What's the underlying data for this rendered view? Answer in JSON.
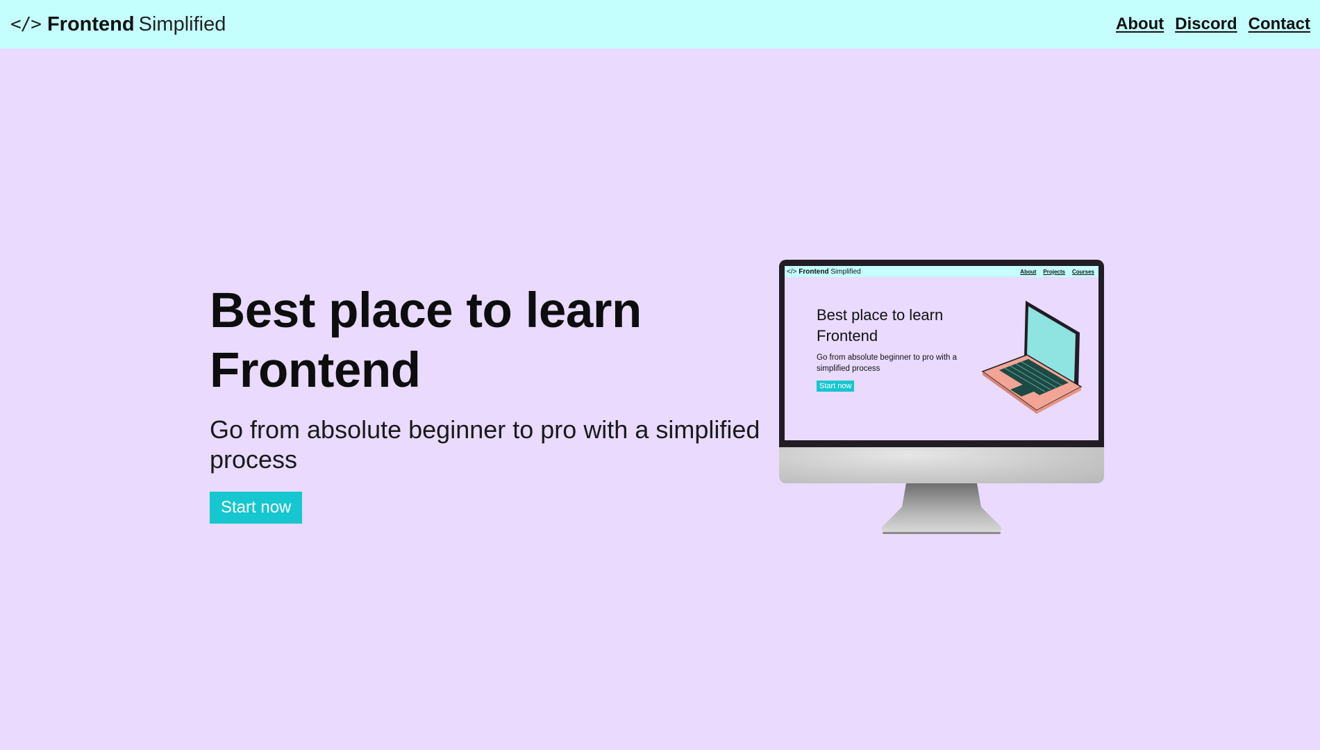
{
  "header": {
    "brand_icon": "</>",
    "brand_bold": "Frontend",
    "brand_light": "Simplified",
    "links": [
      "About",
      "Discord",
      "Contact"
    ]
  },
  "hero": {
    "title_line1": "Best place to learn",
    "title_line2": "Frontend",
    "subtitle": "Go from absolute beginner to pro with a simplified process",
    "cta_label": "Start now"
  },
  "monitor_screen": {
    "brand_icon": "</>",
    "brand_bold": "Frontend",
    "brand_light": "Simplified",
    "links": [
      "About",
      "Projects",
      "Courses"
    ],
    "title_line1": "Best place to learn",
    "title_line2": "Frontend",
    "subtitle": "Go from absolute beginner to pro with a simplified process",
    "cta_label": "Start now"
  },
  "colors": {
    "page_bg": "#e9dafe",
    "navbar_bg": "#c4fefd",
    "accent": "#16c7cf",
    "laptop_body": "#f2a595",
    "laptop_screen": "#8fe3e0"
  },
  "icons": {
    "brand": "code-brackets-icon",
    "illustration": "laptop-illustration",
    "device": "monitor-illustration"
  }
}
